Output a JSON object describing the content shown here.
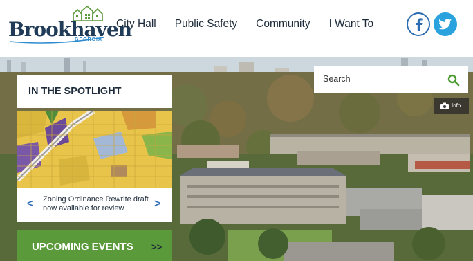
{
  "logo": {
    "name": "Brookhaven",
    "subtitle": "GEORGIA"
  },
  "nav": {
    "items": [
      "City Hall",
      "Public Safety",
      "Community",
      "I Want To"
    ]
  },
  "social": {
    "facebook_icon": "facebook-icon",
    "twitter_icon": "twitter-icon"
  },
  "search": {
    "placeholder": "Search",
    "icon": "search-icon"
  },
  "photo_info": {
    "label": "Info",
    "icon": "camera-icon"
  },
  "spotlight": {
    "title": "IN THE SPOTLIGHT",
    "caption": "Zoning Ordinance Rewrite draft now available for review",
    "prev": "<",
    "next": ">"
  },
  "events": {
    "label": "UPCOMING EVENTS",
    "arrow": ">>"
  },
  "colors": {
    "brand_navy": "#1f3b57",
    "brand_blue": "#2f8ccf",
    "accent_green": "#5a9a3a",
    "search_green": "#4b9a2f"
  }
}
